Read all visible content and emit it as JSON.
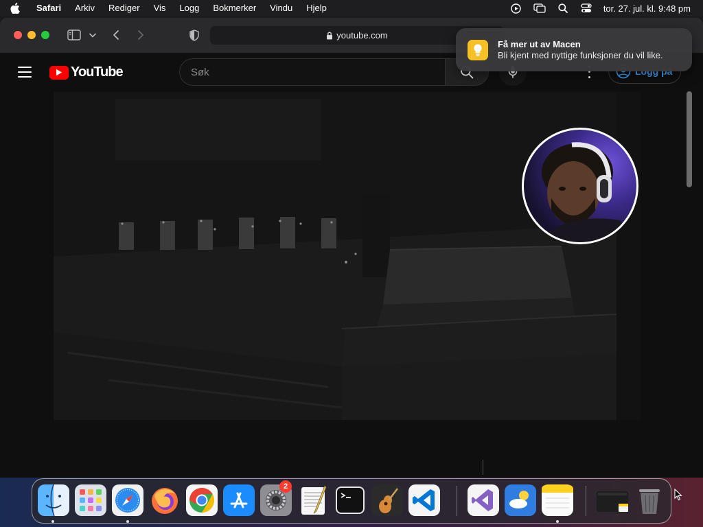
{
  "menubar": {
    "app_name": "Safari",
    "menus": [
      "Arkiv",
      "Rediger",
      "Vis",
      "Logg",
      "Bokmerker",
      "Vindu",
      "Hjelp"
    ],
    "status_icons": [
      "play-circle-icon",
      "screen-mirroring-icon",
      "spotlight-search-icon",
      "control-center-icon"
    ],
    "clock": "tor. 27. jul. kl. 9:48 pm"
  },
  "safari": {
    "url": "youtube.com",
    "toolbar_icons": [
      "sidebar-icon",
      "chevron-down-icon",
      "back-icon",
      "forward-icon",
      "privacy-shield-icon",
      "lock-icon"
    ]
  },
  "youtube": {
    "logo_text": "YouTube",
    "search_placeholder": "Søk",
    "signin_label": "Logg på"
  },
  "notification": {
    "title": "Få mer ut av Macen",
    "body": "Bli kjent med nyttige funksjoner du vil like.",
    "icon": "lightbulb-icon"
  },
  "dock": {
    "apps": [
      {
        "name": "finder",
        "running": true
      },
      {
        "name": "launchpad",
        "running": false
      },
      {
        "name": "safari",
        "running": true
      },
      {
        "name": "firefox",
        "running": false
      },
      {
        "name": "chrome",
        "running": false
      },
      {
        "name": "app-store",
        "running": false
      },
      {
        "name": "system-settings",
        "running": false,
        "badge": "2"
      },
      {
        "name": "textedit",
        "running": false
      },
      {
        "name": "terminal",
        "running": false
      },
      {
        "name": "garageband",
        "running": false
      },
      {
        "name": "vscode",
        "running": false
      },
      {
        "name": "visual-studio",
        "running": false
      },
      {
        "name": "weather",
        "running": false
      },
      {
        "name": "notes",
        "running": true
      },
      {
        "name": "downloads-stack",
        "running": false
      },
      {
        "name": "trash",
        "running": false
      }
    ],
    "accent_colors": {
      "badge": "#ff3b30",
      "youtube_red": "#ff0000",
      "link_blue": "#3ea6ff"
    }
  }
}
